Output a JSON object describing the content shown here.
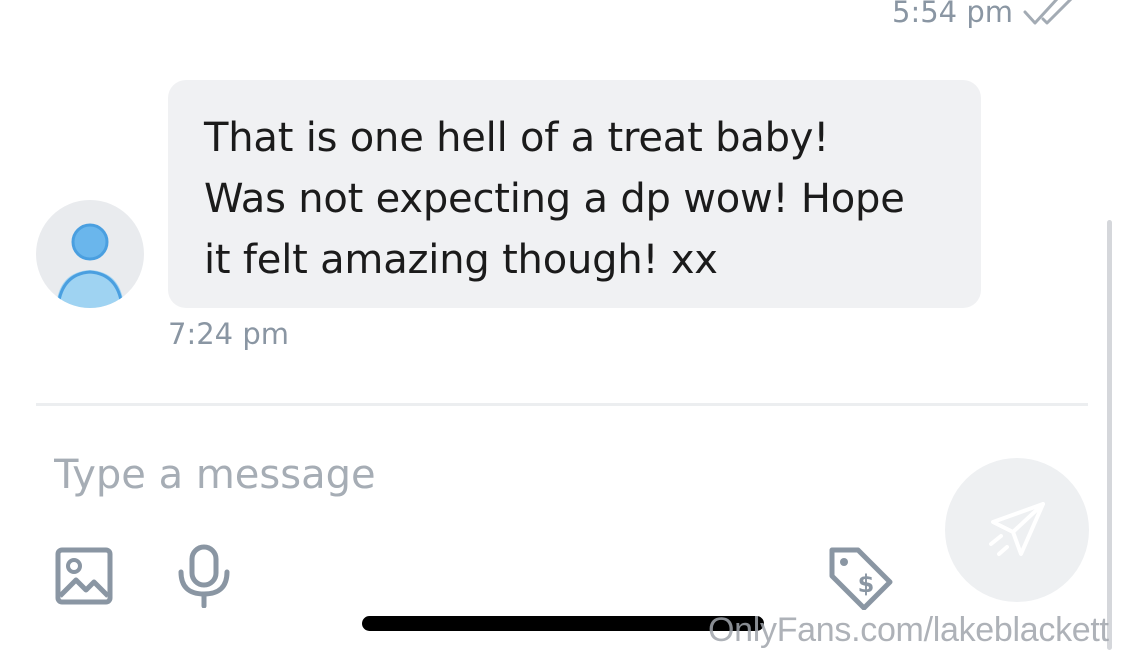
{
  "sent_message": {
    "time": "5:54 pm",
    "status_icon": "double-check-icon"
  },
  "received_message": {
    "text": "That is one hell of a treat baby!\nWas not expecting a dp wow! Hope\nit felt amazing though! xx",
    "time": "7:24 pm",
    "avatar_icon": "default-user-avatar"
  },
  "composer": {
    "placeholder": "Type a message",
    "value": "",
    "tools": [
      "image-icon",
      "microphone-icon",
      "price-tag-icon"
    ],
    "send_icon": "paper-plane-icon"
  },
  "watermark": "OnlyFans.com/lakeblackett",
  "colors": {
    "bubble": "#f0f1f3",
    "muted_text": "#8a96a3",
    "avatar_blue": "#5aaee8",
    "icon_gray": "#8a96a3"
  }
}
